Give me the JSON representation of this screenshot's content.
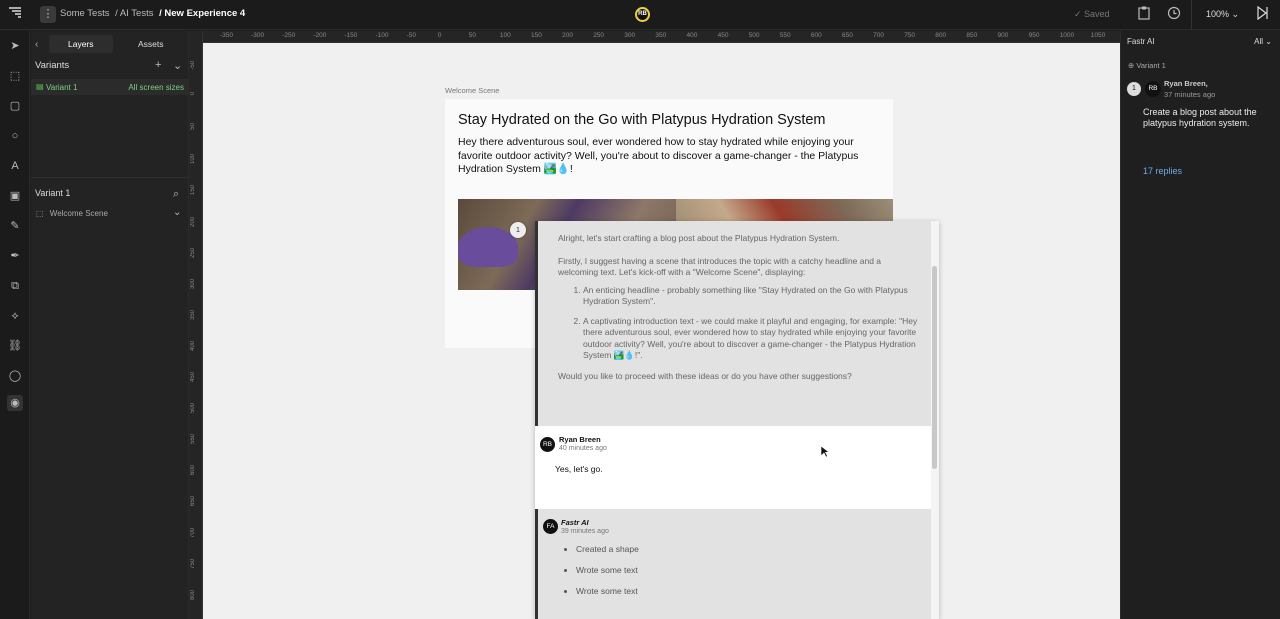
{
  "topbar": {
    "breadcrumbs": [
      "Some Tests",
      "/ AI Tests",
      "/ New Experience 4"
    ],
    "presence_initials": "RB",
    "saved": "Saved",
    "zoom": "100%"
  },
  "left_panel": {
    "tabs": [
      "Layers",
      "Assets"
    ],
    "variants_title": "Variants",
    "variant_item": {
      "name": "Variant 1",
      "sizes": "All screen sizes"
    },
    "layers_title": "Variant 1",
    "scene_item": "Welcome Scene"
  },
  "ruler": {
    "top_ticks": [
      "-350",
      "-300",
      "-250",
      "-200",
      "-150",
      "-100",
      "-50",
      "0",
      "50",
      "100",
      "150",
      "200",
      "250",
      "300",
      "350",
      "400",
      "450",
      "500",
      "550",
      "600",
      "650",
      "700",
      "750",
      "800",
      "850",
      "900",
      "950",
      "1000",
      "1050"
    ],
    "left_ticks": [
      "-50",
      "0",
      "50",
      "100",
      "150",
      "200",
      "250",
      "300",
      "350",
      "400",
      "450",
      "500",
      "550",
      "600",
      "650",
      "700",
      "750",
      "800"
    ]
  },
  "scene": {
    "label": "Welcome Scene",
    "headline": "Stay Hydrated on the Go with Platypus Hydration System",
    "intro": "Hey there adventurous soul, ever wondered how to stay hydrated while enjoying your favorite outdoor activity? Well, you're about to discover a game-changer - the Platypus Hydration System 🏞️💧!",
    "pin_number": "1"
  },
  "thread": {
    "ai_message": {
      "p1": "Alright, let's start crafting a blog post about the Platypus Hydration System.",
      "p2": "Firstly, I suggest having a scene that introduces the topic with a catchy headline and a welcoming text. Let's kick-off with a \"Welcome Scene\", displaying:",
      "item1": "An enticing headline - probably something like \"Stay Hydrated on the Go with Platypus Hydration System\".",
      "item2": "A captivating introduction text - we could make it playful and engaging, for example: \"Hey there adventurous soul, ever wondered how to stay hydrated while enjoying your favorite outdoor activity? Well, you're about to discover a game-changer - the Platypus Hydration System 🏞️💧!\".",
      "p3": "Would you like to proceed with these ideas or do you have other suggestions?"
    },
    "user_message": {
      "initials": "RB",
      "author": "Ryan Breen",
      "time": "40 minutes ago",
      "text": "Yes, let's go."
    },
    "ai_message2": {
      "initials": "FA",
      "author": "Fastr AI",
      "time": "39 minutes ago",
      "actions": [
        "Created a shape",
        "Wrote some text",
        "Wrote some text"
      ]
    }
  },
  "right_panel": {
    "title": "Fastr AI",
    "filter": "All",
    "variant": "Variant 1",
    "comment": {
      "number": "1",
      "initials": "RB",
      "author": "Ryan Breen,",
      "time": "37 minutes ago",
      "text": "Create a blog post about the platypus hydration system.",
      "replies": "17 replies"
    }
  }
}
